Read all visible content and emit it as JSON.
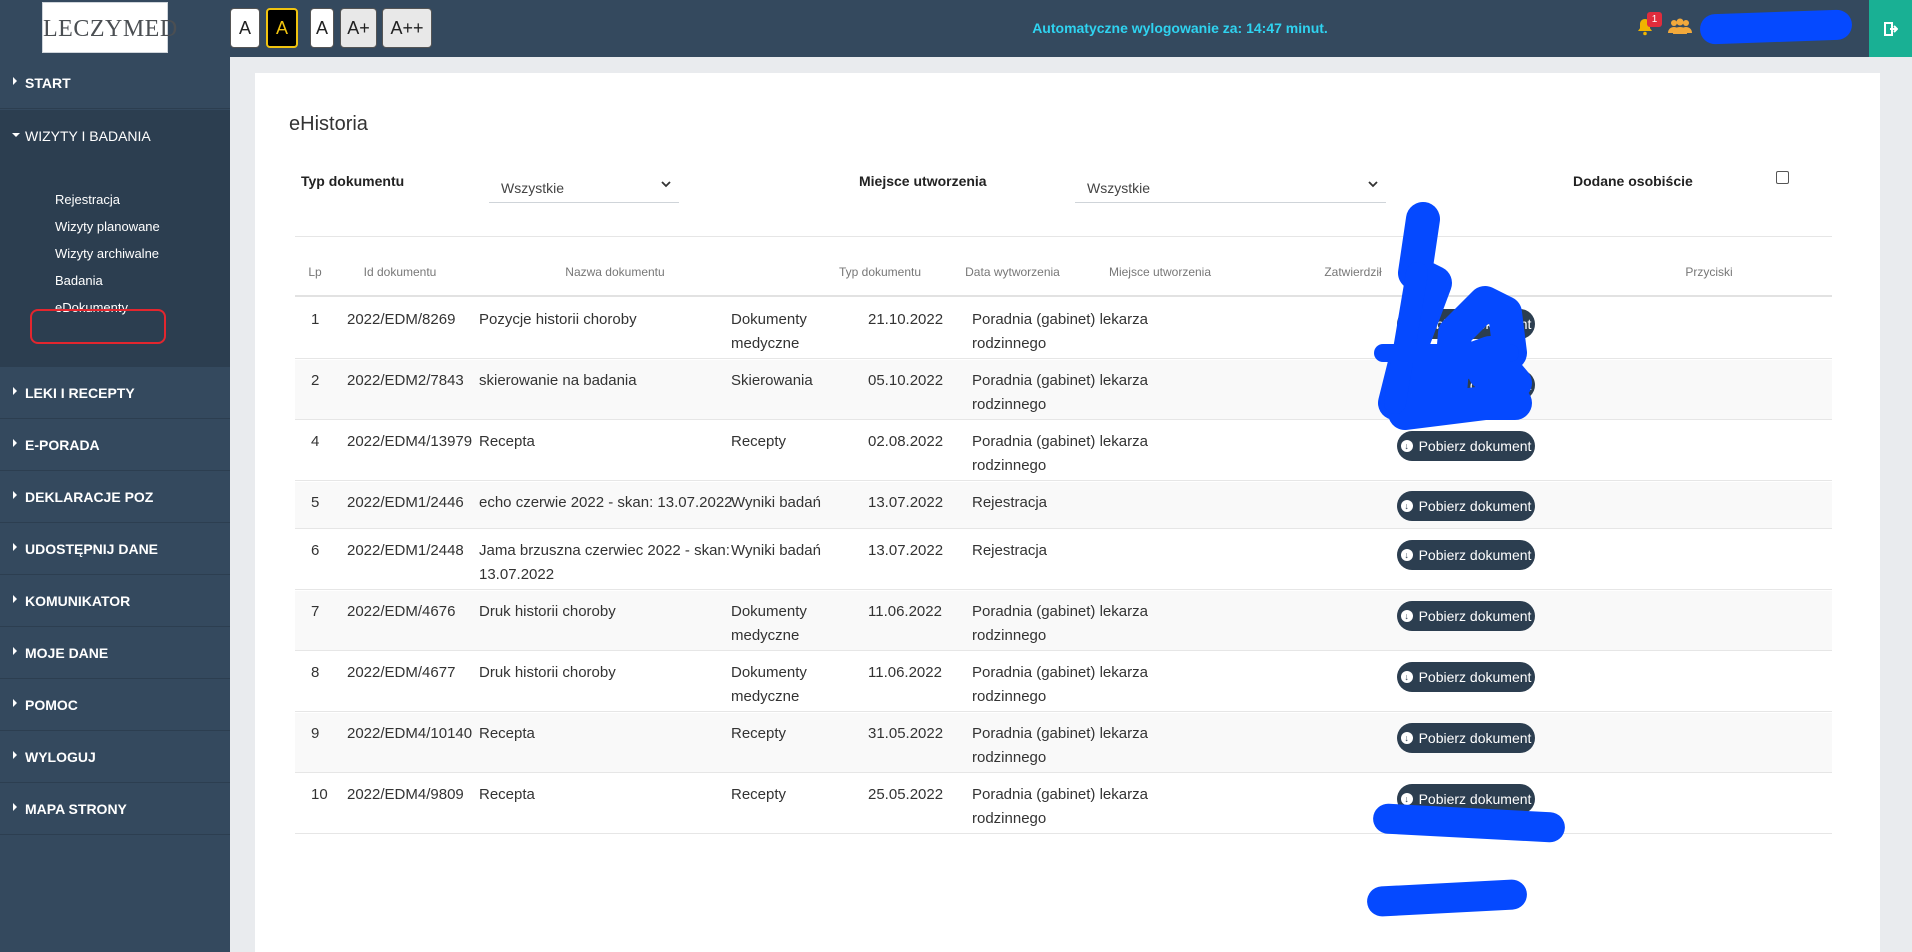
{
  "brand": {
    "logo_text": "LECZYMED",
    "logo_small": ""
  },
  "header": {
    "font_sizes": [
      "A",
      "A",
      "A",
      "A+",
      "A++"
    ],
    "active_font_index": 1,
    "logout_timer": "Automatyczne wylogowanie za: 14:47 minut.",
    "notification_count": "1"
  },
  "sidebar": {
    "items": [
      {
        "label": "START"
      },
      {
        "label": "WIZYTY I BADANIA"
      },
      {
        "label": "LEKI I RECEPTY"
      },
      {
        "label": "E-PORADA"
      },
      {
        "label": "DEKLARACJE POZ"
      },
      {
        "label": "UDOSTĘPNIJ DANE"
      },
      {
        "label": "KOMUNIKATOR"
      },
      {
        "label": "MOJE DANE"
      },
      {
        "label": "POMOC"
      },
      {
        "label": "WYLOGUJ"
      },
      {
        "label": "MAPA STRONY"
      }
    ],
    "submenu": [
      {
        "label": "Rejestracja"
      },
      {
        "label": "Wizyty planowane"
      },
      {
        "label": "Wizyty archiwalne"
      },
      {
        "label": "Badania"
      },
      {
        "label": "eDokumenty"
      }
    ]
  },
  "main": {
    "title": "eHistoria",
    "filters": {
      "type_label": "Typ dokumentu",
      "type_value": "Wszystkie",
      "place_label": "Miejsce utworzenia",
      "place_value": "Wszystkie",
      "personal_label": "Dodane osobiście",
      "personal_checked": false
    },
    "table": {
      "headers": [
        "Lp",
        "Id dokumentu",
        "Nazwa dokumentu",
        "Typ dokumentu",
        "Data wytworzenia",
        "Miejsce utworzenia",
        "Zatwierdził",
        "Przyciski"
      ],
      "download_label": "Pobierz dokument",
      "rows": [
        {
          "lp": "1",
          "id": "2022/EDM/8269",
          "name": [
            "Pozycje historii choroby"
          ],
          "type": [
            "Dokumenty",
            "medyczne"
          ],
          "date": "21.10.2022",
          "place": [
            "Poradnia (gabinet) lekarza",
            "rodzinnego"
          ]
        },
        {
          "lp": "2",
          "id": "2022/EDM2/7843",
          "name": [
            "skierowanie na badania"
          ],
          "type": [
            "Skierowania"
          ],
          "date": "05.10.2022",
          "place": [
            "Poradnia (gabinet) lekarza",
            "rodzinnego"
          ]
        },
        {
          "lp": "4",
          "id": "2022/EDM4/13979",
          "name": [
            "Recepta"
          ],
          "type": [
            "Recepty"
          ],
          "date": "02.08.2022",
          "place": [
            "Poradnia (gabinet) lekarza",
            "rodzinnego"
          ]
        },
        {
          "lp": "5",
          "id": "2022/EDM1/2446",
          "name": [
            "echo czerwie 2022 - skan: 13.07.2022"
          ],
          "type": [
            "Wyniki badań"
          ],
          "date": "13.07.2022",
          "place": [
            "Rejestracja"
          ]
        },
        {
          "lp": "6",
          "id": "2022/EDM1/2448",
          "name": [
            "Jama brzuszna czerwiec 2022 - skan:",
            "13.07.2022"
          ],
          "type": [
            "Wyniki badań"
          ],
          "date": "13.07.2022",
          "place": [
            "Rejestracja"
          ]
        },
        {
          "lp": "7",
          "id": "2022/EDM/4676",
          "name": [
            "Druk historii choroby"
          ],
          "type": [
            "Dokumenty",
            "medyczne"
          ],
          "date": "11.06.2022",
          "place": [
            "Poradnia (gabinet) lekarza",
            "rodzinnego"
          ]
        },
        {
          "lp": "8",
          "id": "2022/EDM/4677",
          "name": [
            "Druk historii choroby"
          ],
          "type": [
            "Dokumenty",
            "medyczne"
          ],
          "date": "11.06.2022",
          "place": [
            "Poradnia (gabinet) lekarza",
            "rodzinnego"
          ]
        },
        {
          "lp": "9",
          "id": "2022/EDM4/10140",
          "name": [
            "Recepta"
          ],
          "type": [
            "Recepty"
          ],
          "date": "31.05.2022",
          "place": [
            "Poradnia (gabinet) lekarza",
            "rodzinnego"
          ]
        },
        {
          "lp": "10",
          "id": "2022/EDM4/9809",
          "name": [
            "Recepta"
          ],
          "type": [
            "Recepty"
          ],
          "date": "25.05.2022",
          "place": [
            "Poradnia (gabinet) lekarza",
            "rodzinnego"
          ]
        }
      ]
    }
  }
}
